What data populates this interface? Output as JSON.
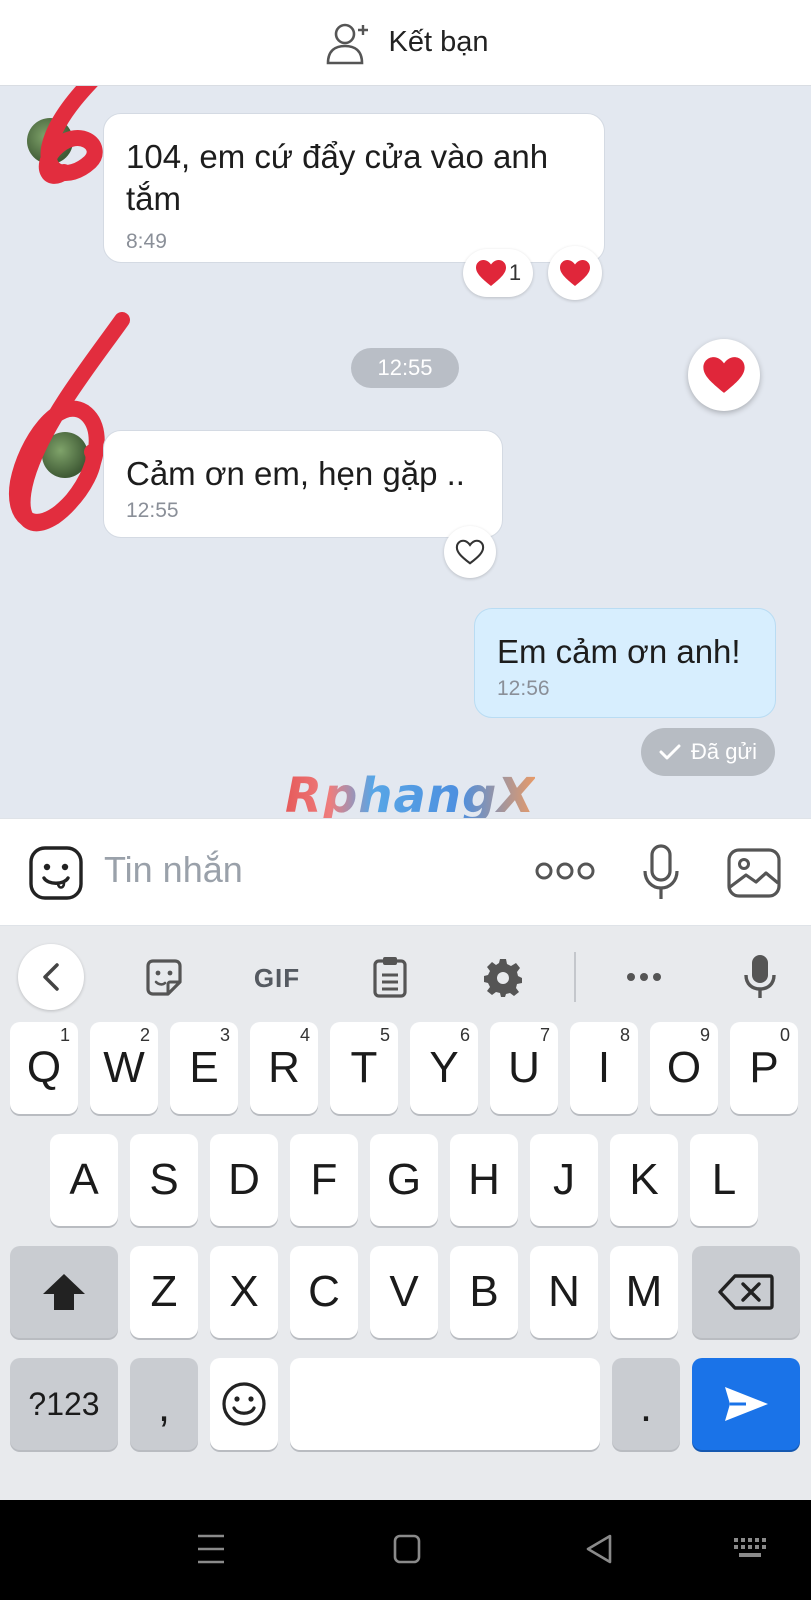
{
  "header": {
    "add_friend_label": "Kết bạn",
    "add_friend_icon": "add-user-icon"
  },
  "messages": [
    {
      "text": "104, em cứ đẩy cửa vào anh tắm",
      "time": "8:49",
      "direction": "received",
      "reaction_count": "1"
    },
    {
      "text": "Cảm ơn em, hẹn gặp ..",
      "time": "12:55",
      "direction": "received"
    },
    {
      "text": "Em cảm ơn anh!",
      "time": "12:56",
      "direction": "sent"
    }
  ],
  "time_separator": "12:55",
  "status": {
    "label": "Đã gửi"
  },
  "watermark": {
    "text": "RphangX"
  },
  "composer": {
    "placeholder": "Tin nhắn"
  },
  "keyboard": {
    "toolbar": [
      "back",
      "sticker",
      "GIF",
      "clipboard",
      "settings",
      "more",
      "mic"
    ],
    "gif_label": "GIF",
    "row1": [
      {
        "key": "Q",
        "hint": "1"
      },
      {
        "key": "W",
        "hint": "2"
      },
      {
        "key": "E",
        "hint": "3"
      },
      {
        "key": "R",
        "hint": "4"
      },
      {
        "key": "T",
        "hint": "5"
      },
      {
        "key": "Y",
        "hint": "6"
      },
      {
        "key": "U",
        "hint": "7"
      },
      {
        "key": "I",
        "hint": "8"
      },
      {
        "key": "O",
        "hint": "9"
      },
      {
        "key": "P",
        "hint": "0"
      }
    ],
    "row2": [
      "A",
      "S",
      "D",
      "F",
      "G",
      "H",
      "J",
      "K",
      "L"
    ],
    "row3": [
      "Z",
      "X",
      "C",
      "V",
      "B",
      "N",
      "M"
    ],
    "symbols_key": "?123",
    "comma_key": ",",
    "period_key": "."
  },
  "colors": {
    "accent": "#1a73e8",
    "sent_bubble": "#d7eefe",
    "chat_bg": "#e3e8f0",
    "heart": "#e0263a"
  }
}
